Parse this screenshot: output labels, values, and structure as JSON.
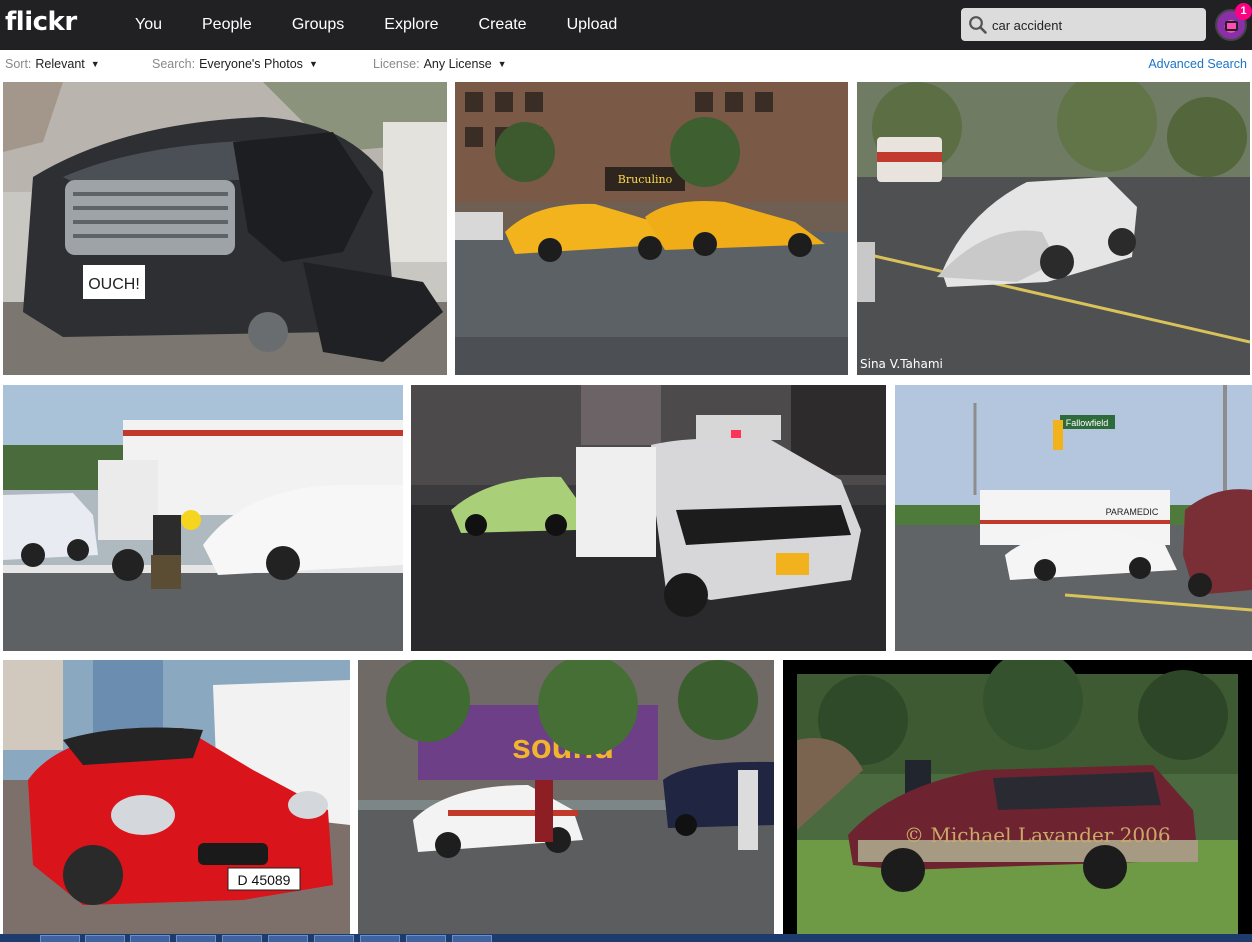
{
  "header": {
    "logo": "flickr",
    "nav": [
      "You",
      "People",
      "Groups",
      "Explore",
      "Create",
      "Upload"
    ],
    "search_value": "car accident",
    "notification_count": "1"
  },
  "filters": {
    "sort": {
      "label": "Sort:",
      "value": "Relevant"
    },
    "search": {
      "label": "Search:",
      "value": "Everyone's Photos"
    },
    "license": {
      "label": "License:",
      "value": "Any License"
    },
    "advanced": "Advanced Search"
  },
  "photos": {
    "p2": {
      "plate": "OUCH!"
    },
    "p3": {
      "watermark": "Sina V.Tahami",
      "sign": "Bruculino"
    },
    "p6": {
      "sign": "Fallowfield",
      "truck_label": "PARAMEDIC"
    },
    "p7": {
      "plate": "D 45089"
    },
    "p8": {
      "sign": "sound"
    },
    "p9": {
      "watermark": "© Michael Lavander 2006"
    }
  },
  "colors": {
    "topbar": "#212124",
    "link": "#1c74c6",
    "badge": "#ff0084"
  }
}
